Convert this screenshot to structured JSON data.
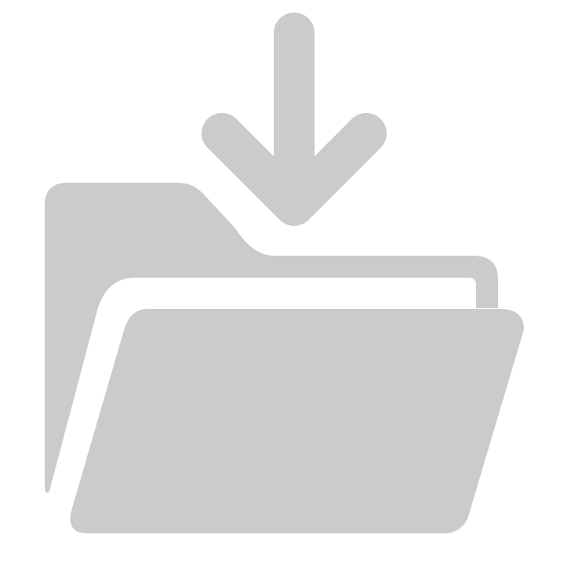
{
  "icon": {
    "name": "download-to-folder-icon",
    "fill_color": "#cbcbcb",
    "background_color": "#ffffff"
  }
}
